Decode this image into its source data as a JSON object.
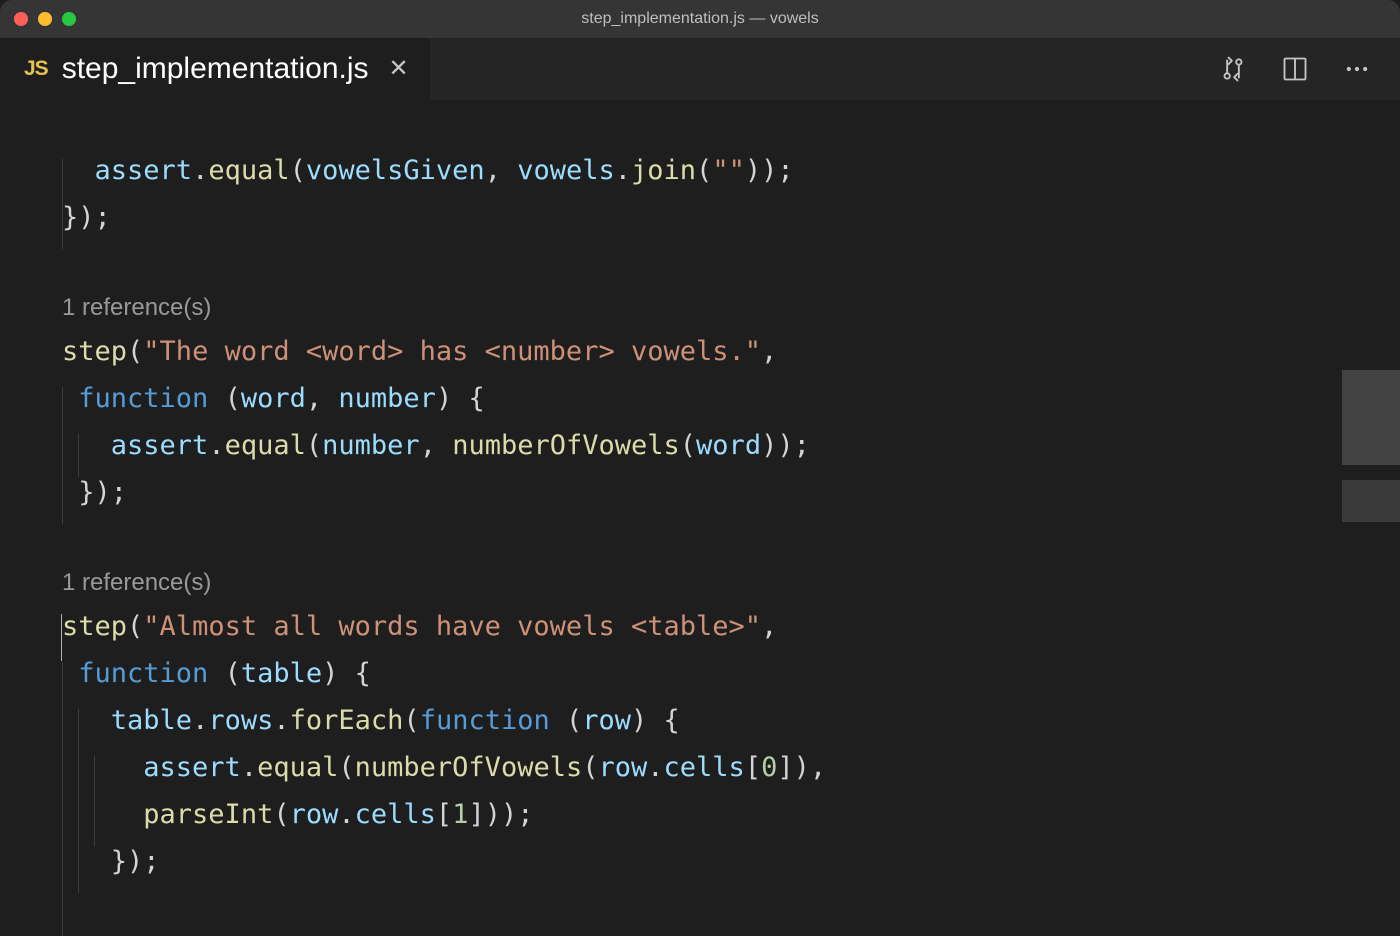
{
  "window": {
    "title": "step_implementation.js — vowels"
  },
  "traffic_lights": {
    "close": "close",
    "minimize": "minimize",
    "zoom": "zoom"
  },
  "tab": {
    "icon_text": "JS",
    "label": "step_implementation.js",
    "close_label": "×"
  },
  "actions": {
    "diff": "open-changes",
    "split": "split-editor",
    "more": "more-actions"
  },
  "codelens": {
    "ref1": "1 reference(s)",
    "ref2": "1 reference(s)"
  },
  "tokens": {
    "assert": "assert",
    "equal": "equal",
    "vowelsGiven": "vowelsGiven",
    "vowels": "vowels",
    "join": "join",
    "empty_str": "\"\"",
    "step": "step",
    "str_word_has_vowels": "\"The word <word> has <number> vowels.\"",
    "function": "function",
    "word": "word",
    "number": "number",
    "numberOfVowels": "numberOfVowels",
    "str_almost_all": "\"Almost all words have vowels <table>\"",
    "table": "table",
    "rows": "rows",
    "forEach": "forEach",
    "row": "row",
    "cells": "cells",
    "zero": "0",
    "one": "1",
    "parseInt": "parseInt"
  }
}
